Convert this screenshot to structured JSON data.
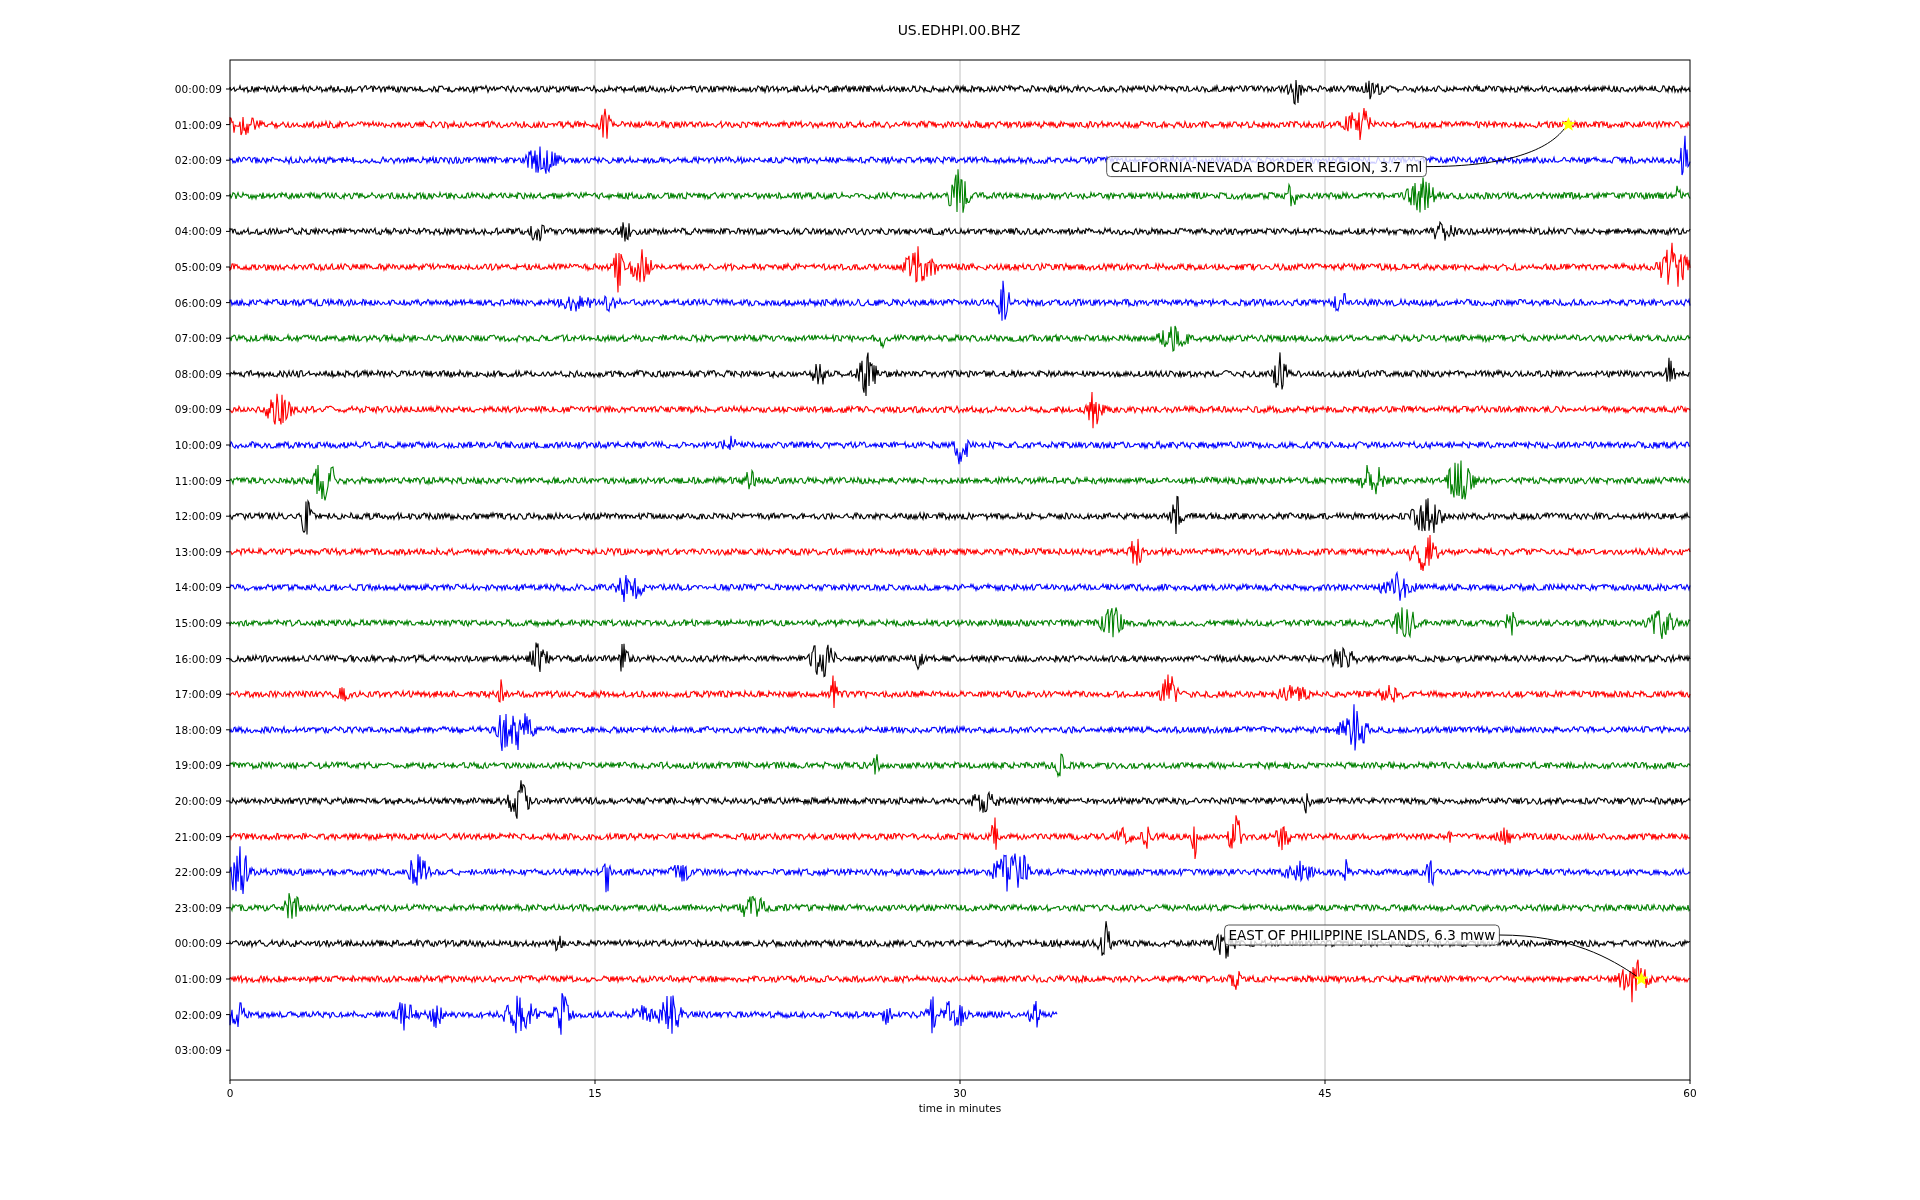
{
  "figure": {
    "title": "US.EDHPI.00.BHZ"
  },
  "plot": {
    "xlabel": "time in minutes",
    "xticks": [
      "0",
      "15",
      "30",
      "45",
      "60"
    ],
    "rows": [
      {
        "label": "00:00:09",
        "color": "#000000",
        "level": 1
      },
      {
        "label": "01:00:09",
        "color": "#ff0000",
        "level": 1,
        "event": {
          "text": "CALIFORNIA-NEVADA BORDER REGION, 3.7 ml",
          "level": 0.9167
        }
      },
      {
        "label": "02:00:09",
        "color": "#0000ff",
        "level": 1
      },
      {
        "label": "03:00:09",
        "color": "#008000",
        "level": 1
      },
      {
        "label": "04:00:09",
        "color": "#000000",
        "level": 1
      },
      {
        "label": "05:00:09",
        "color": "#ff0000",
        "level": 1
      },
      {
        "label": "06:00:09",
        "color": "#0000ff",
        "level": 1
      },
      {
        "label": "07:00:09",
        "color": "#008000",
        "level": 1
      },
      {
        "label": "08:00:09",
        "color": "#000000",
        "level": 1
      },
      {
        "label": "09:00:09",
        "color": "#ff0000",
        "level": 1
      },
      {
        "label": "10:00:09",
        "color": "#0000ff",
        "level": 1
      },
      {
        "label": "11:00:09",
        "color": "#008000",
        "level": 1
      },
      {
        "label": "12:00:09",
        "color": "#000000",
        "level": 1
      },
      {
        "label": "13:00:09",
        "color": "#ff0000",
        "level": 1
      },
      {
        "label": "14:00:09",
        "color": "#0000ff",
        "level": 1
      },
      {
        "label": "15:00:09",
        "color": "#008000",
        "level": 1
      },
      {
        "label": "16:00:09",
        "color": "#000000",
        "level": 1
      },
      {
        "label": "17:00:09",
        "color": "#ff0000",
        "level": 1
      },
      {
        "label": "18:00:09",
        "color": "#0000ff",
        "level": 1
      },
      {
        "label": "19:00:09",
        "color": "#008000",
        "level": 1
      },
      {
        "label": "20:00:09",
        "color": "#000000",
        "level": 1
      },
      {
        "label": "21:00:09",
        "color": "#ff0000",
        "level": 1
      },
      {
        "label": "22:00:09",
        "color": "#0000ff",
        "level": 1
      },
      {
        "label": "23:00:09",
        "color": "#008000",
        "level": 1
      },
      {
        "label": "00:00:09",
        "color": "#000000",
        "level": 1
      },
      {
        "label": "01:00:09",
        "color": "#ff0000",
        "level": 1,
        "event": {
          "text": "EAST OF PHILIPPINE ISLANDS, 6.3 mww",
          "level": 0.9667
        }
      },
      {
        "label": "02:00:09",
        "color": "#0000ff",
        "level": 0.5667
      },
      {
        "label": "03:00:09"
      }
    ]
  }
}
